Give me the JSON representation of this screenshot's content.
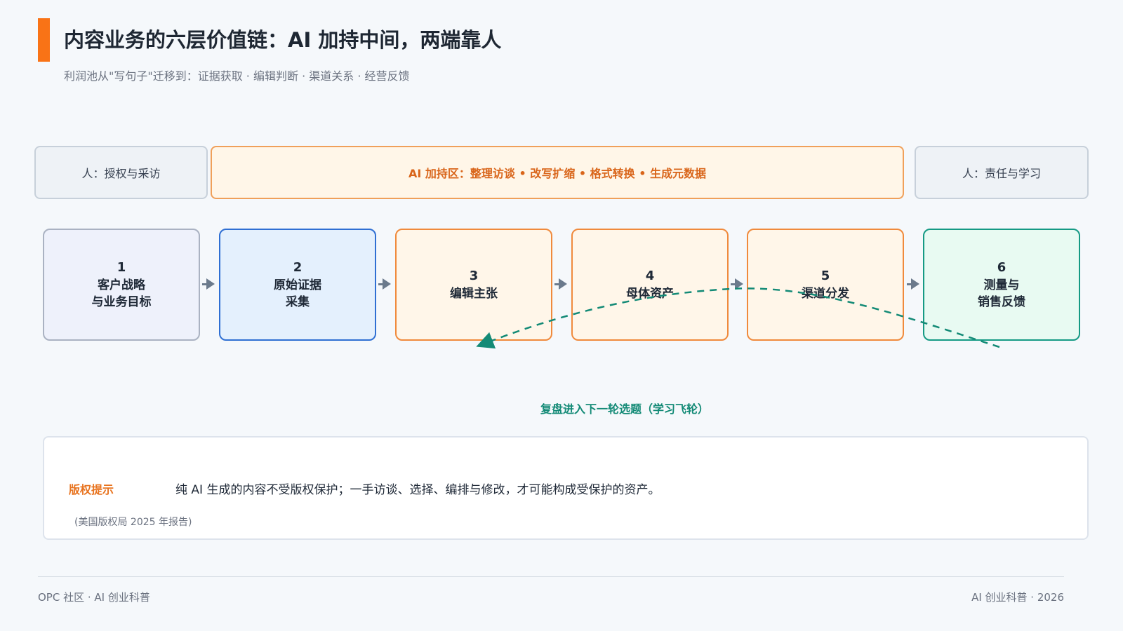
{
  "header": {
    "title": "内容业务的六层价值链：AI 加持中间，两端靠人",
    "subtitle": "利润池从\"写句子\"迁移到：证据获取 · 编辑判断 · 渠道关系 · 经营反馈"
  },
  "zones": {
    "left": "人：授权与采访",
    "middle": "AI 加持区：整理访谈 • 改写扩缩 • 格式转换 • 生成元数据",
    "right": "人：责任与学习"
  },
  "steps": [
    {
      "num": "1",
      "line1": "客户战略",
      "line2": "与业务目标"
    },
    {
      "num": "2",
      "line1": "原始证据",
      "line2": "采集"
    },
    {
      "num": "3",
      "line1": "编辑主张",
      "line2": ""
    },
    {
      "num": "4",
      "line1": "母体资产",
      "line2": ""
    },
    {
      "num": "5",
      "line1": "渠道分发",
      "line2": ""
    },
    {
      "num": "6",
      "line1": "测量与",
      "line2": "销售反馈"
    }
  ],
  "feedback_loop": {
    "label": "复盘进入下一轮选题（学习飞轮）",
    "from_step": "6",
    "to_step": "3"
  },
  "note": {
    "title": "版权提示",
    "text": "纯 AI 生成的内容不受版权保护；一手访谈、选择、编排与修改，才可能构成受保护的资产。",
    "source": "(美国版权局 2025 年报告)"
  },
  "footer": {
    "left": "OPC 社区 · AI 创业科普",
    "right": "AI 创业科普 · 2026"
  },
  "colors": {
    "accent": "#f97316",
    "ai_zone": "#d9651a",
    "step2_border": "#2f6fd3",
    "step_mid_border": "#f08a3c",
    "step6_border": "#159a84",
    "loop": "#138a76"
  }
}
